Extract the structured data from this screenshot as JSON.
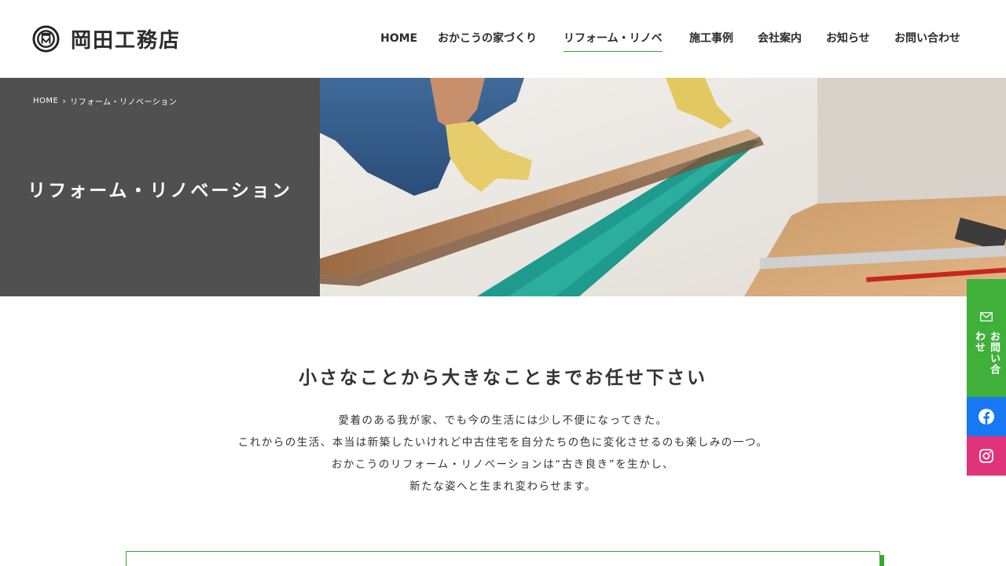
{
  "site": {
    "logo_text": "岡田工務店",
    "logo_icon": "logo-mark-icon"
  },
  "nav": {
    "items": [
      {
        "label": "HOME"
      },
      {
        "label": "おかこうの家づくり"
      },
      {
        "label": "リフォーム・リノベ"
      },
      {
        "label": "施工事例"
      },
      {
        "label": "会社案内"
      },
      {
        "label": "お知らせ"
      },
      {
        "label": "お問い合わせ"
      }
    ],
    "active_index": 2
  },
  "hero": {
    "breadcrumb": {
      "home": "HOME",
      "separator": "›",
      "current": "リフォーム・リノベーション"
    },
    "title": "リフォーム・リノベーション"
  },
  "main": {
    "heading": "小さなことから大きなことまでお任せ下さい",
    "intro": [
      "愛着のある我が家、でも今の生活には少し不便になってきた。",
      "これからの生活、本当は新築したいけれど中古住宅を自分たちの色に変化させるのも楽しみの一つ。",
      "おかこうのリフォーム・リノベーションは“古き良き”を生かし、",
      "新たな姿へと生まれ変わらせます。"
    ]
  },
  "side": {
    "contact_label": "お問い合わせ",
    "contact_icon": "mail-icon",
    "facebook_icon": "facebook-icon",
    "instagram_icon": "instagram-icon"
  },
  "colors": {
    "accent": "#3aa535",
    "side_contact": "#3fb03a",
    "facebook": "#1877f2",
    "instagram": "#e0337a",
    "hero_panel": "#505050"
  }
}
